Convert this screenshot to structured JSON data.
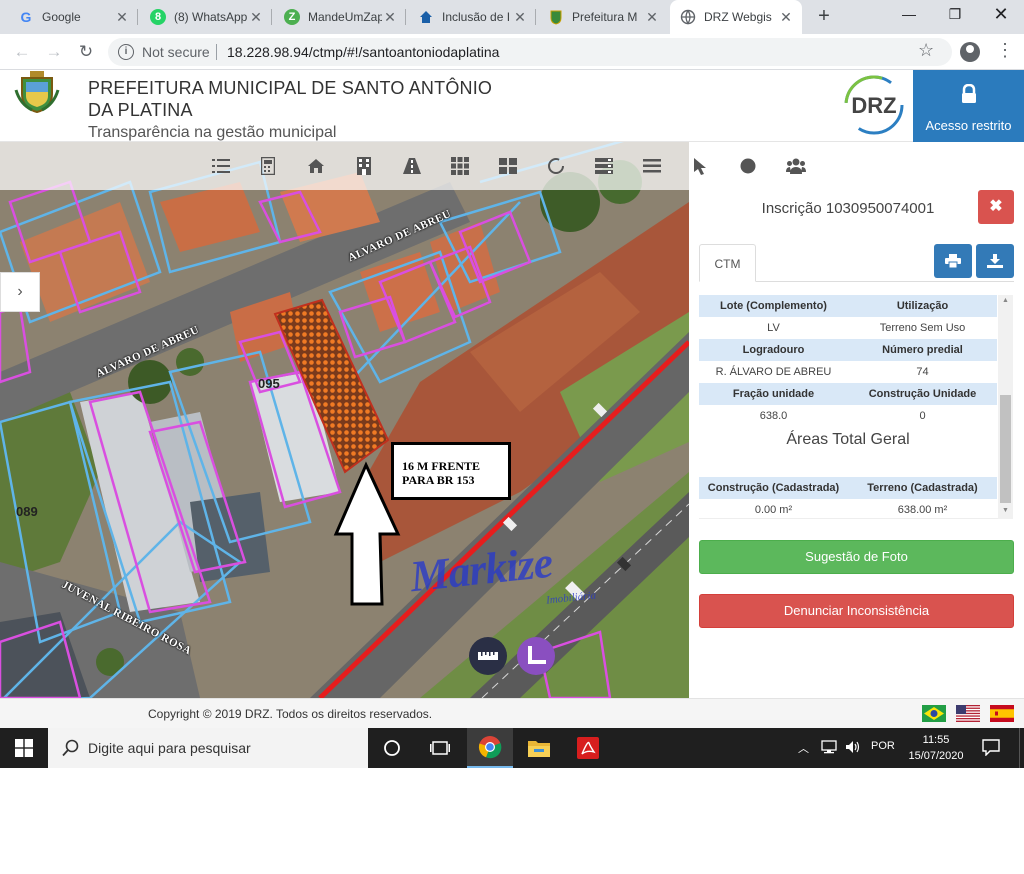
{
  "browser": {
    "tabs": [
      {
        "label": "Google",
        "icon": "google-icon"
      },
      {
        "label": "(8) WhatsApp",
        "icon": "whatsapp-icon"
      },
      {
        "label": "MandeUmZap",
        "icon": "mandeumzap-icon"
      },
      {
        "label": "Inclusão de I",
        "icon": "home-icon"
      },
      {
        "label": "Prefeitura M",
        "icon": "crest-icon"
      },
      {
        "label": "DRZ Webgis",
        "icon": "globe-icon",
        "active": true
      }
    ],
    "url_security": "Not secure",
    "url": "18.228.98.94/ctmp/#!/santoantoniodaplatina"
  },
  "site": {
    "title": "PREFEITURA MUNICIPAL DE SANTO ANTÔNIO DA PLATINA",
    "subtitle": "Transparência na gestão municipal",
    "logo_text": "DRZ",
    "restricted_label": "Acesso restrito"
  },
  "map": {
    "lot_labels": [
      "095",
      "089"
    ],
    "streets": [
      "ALVARO DE ABREU",
      "ALVARO DE ABREU",
      "JUVENAL RIBEIRO ROSA"
    ],
    "annotation_lines": [
      "16 M FRENTE",
      "PARA BR 153"
    ],
    "watermark": "Markize",
    "watermark_sub": "Imobiliária"
  },
  "panel": {
    "inscricao": "Inscrição 1030950074001",
    "tab_label": "CTM",
    "rows": [
      {
        "h1": "Lote (Complemento)",
        "h2": "Utilização",
        "v1": "LV",
        "v2": "Terreno Sem Uso"
      },
      {
        "h1": "Logradouro",
        "h2": "Número predial",
        "v1": "R. ÁLVARO DE ABREU",
        "v2": "74"
      },
      {
        "h1": "Fração unidade",
        "h2": "Construção Unidade",
        "v1": "638.0",
        "v2": "0"
      }
    ],
    "areas_title": "Áreas Total Geral",
    "areas": {
      "h1": "Construção (Cadastrada)",
      "h2": "Terreno (Cadastrada)",
      "v1": "0.00 m²",
      "v2": "638.00 m²"
    },
    "btn_photo": "Sugestão de Foto",
    "btn_report": "Denunciar Inconsistência"
  },
  "footer": {
    "copyright": "Copyright © 2019 DRZ. Todos os direitos reservados."
  },
  "taskbar": {
    "search_placeholder": "Digite aqui para pesquisar",
    "language": "POR",
    "time": "11:55",
    "date": "15/07/2020"
  },
  "colors": {
    "primary": "#337ab7",
    "restricted_bg": "#2b7bbd",
    "success": "#5cb85c",
    "danger": "#d9534f",
    "table_header": "#d9e8f7",
    "parcel_magenta": "#d94fe0",
    "parcel_blue": "#5fb4e8",
    "highway_red": "#e61d1d"
  }
}
